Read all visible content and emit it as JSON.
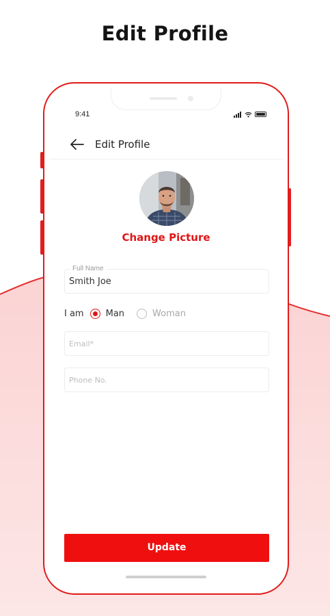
{
  "page": {
    "heading": "Edit Profile"
  },
  "colors": {
    "accent": "#e01616",
    "button": "#f00f0f",
    "wave": "#fde3e3"
  },
  "status_bar": {
    "time": "9:41",
    "icons": [
      "signal-icon",
      "wifi-icon",
      "battery-icon"
    ]
  },
  "app_bar": {
    "back_icon": "arrow-left-icon",
    "title": "Edit Profile"
  },
  "profile": {
    "avatar": "profile-photo",
    "change_picture_label": "Change Picture"
  },
  "form": {
    "full_name": {
      "label": "Full Name",
      "value": "Smith Joe"
    },
    "gender": {
      "label": "I am",
      "options": [
        "Man",
        "Woman"
      ],
      "selected": "Man"
    },
    "email": {
      "placeholder": "Email*",
      "value": ""
    },
    "phone": {
      "placeholder": "Phone No.",
      "value": ""
    },
    "submit_label": "Update"
  }
}
